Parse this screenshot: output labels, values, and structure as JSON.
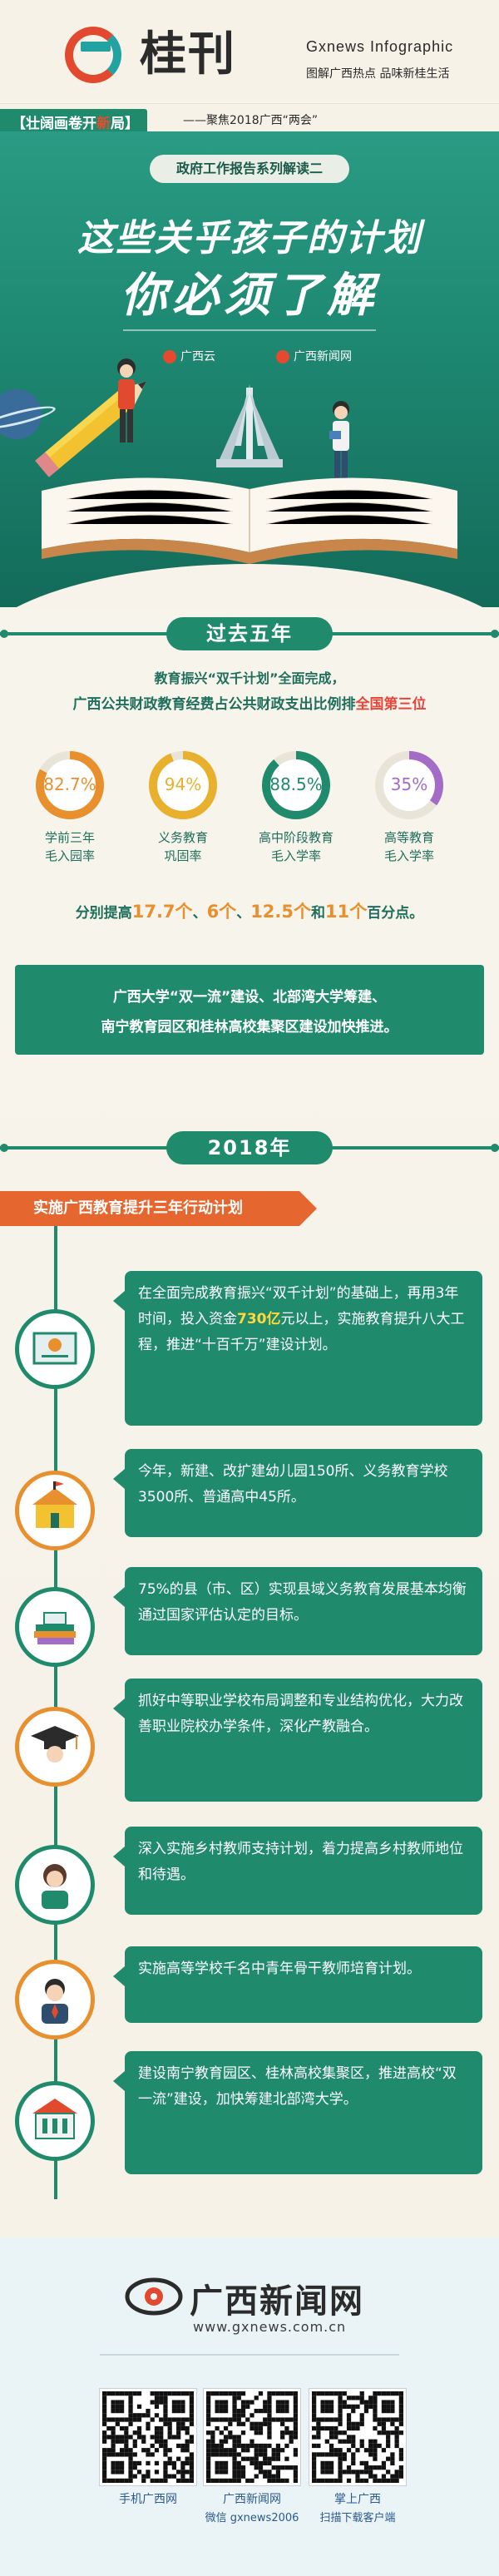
{
  "header": {
    "brand": "桂刊",
    "brand_en": "Gxnews Infographic",
    "tagline": "图解广西热点 品味新桂生活",
    "series_label_prefix": "【壮阔画卷开",
    "series_label_accent": "新",
    "series_label_suffix": "局】",
    "series_sub": "——聚焦2018广西“两会”"
  },
  "hero": {
    "pill": "政府工作报告系列解读二",
    "title_line1": "这些关乎孩子的计划",
    "title_line2": "你必须了解",
    "media_left": "广西云",
    "media_right": "广西新闻网"
  },
  "past": {
    "heading": "过去五年",
    "intro1": "教育振兴“双千计划”全面完成，",
    "intro2_prefix": "广西公共财政教育经费占公共财政支出比例排",
    "intro2_red": "全国第三位",
    "rings": [
      {
        "value": "82.7%",
        "percent": 82.7,
        "color": "#e8902d",
        "label1": "学前三年",
        "label2": "毛入园率"
      },
      {
        "value": "94%",
        "percent": 94,
        "color": "#e8b02d",
        "label1": "义务教育",
        "label2": "巩固率"
      },
      {
        "value": "88.5%",
        "percent": 88.5,
        "color": "#1f8b6c",
        "label1": "高中阶段教育",
        "label2": "毛入学率"
      },
      {
        "value": "35%",
        "percent": 35,
        "color": "#a36cc7",
        "label1": "高等教育",
        "label2": "毛入学率"
      }
    ],
    "increase_prefix": "分别提高",
    "increase_v1": "17.7个",
    "increase_sep1": "、",
    "increase_v2": "6个",
    "increase_sep2": "、",
    "increase_v3": "12.5个",
    "increase_and": "和",
    "increase_v4": "11个",
    "increase_suffix": "百分点。",
    "news_line1": "广西大学“双一流”建设、北部湾大学筹建、",
    "news_line2": "南宁教育园区和桂林高校集聚区建设加快推进。"
  },
  "y2018": {
    "heading": "2018年",
    "ribbon": "实施广西教育提升三年行动计划",
    "items": [
      {
        "text_pre": "在全面完成教育振兴“双千计划”的基础上，再用3年时间，投入资金",
        "highlight": "730亿",
        "text_post": "元以上，实施教育提升八大工程，推进“十百千万”建设计划。"
      },
      {
        "text": "今年，新建、改扩建幼儿园150所、义务教育学校3500所、普通高中45所。"
      },
      {
        "text": "75%的县（市、区）实现县域义务教育发展基本均衡通过国家评估认定的目标。"
      },
      {
        "text": "抓好中等职业学校布局调整和专业结构优化，大力改善职业院校办学条件，深化产教融合。"
      },
      {
        "text": "深入实施乡村教师支持计划，着力提高乡村教师地位和待遇。"
      },
      {
        "text": "实施高等学校千名中青年骨干教师培育计划。"
      },
      {
        "text": "建设南宁教育园区、桂林高校集聚区，推进高校“双一流”建设，加快筹建北部湾大学。"
      }
    ]
  },
  "footer": {
    "logo": "广西新闻网",
    "url": "www.gxnews.com.cn",
    "qr": [
      {
        "label1": "手机广西网",
        "label2": ""
      },
      {
        "label1": "广西新闻网",
        "label2": "微信 gxnews2006"
      },
      {
        "label1": "掌上广西",
        "label2": "扫描下载客户端"
      }
    ]
  }
}
